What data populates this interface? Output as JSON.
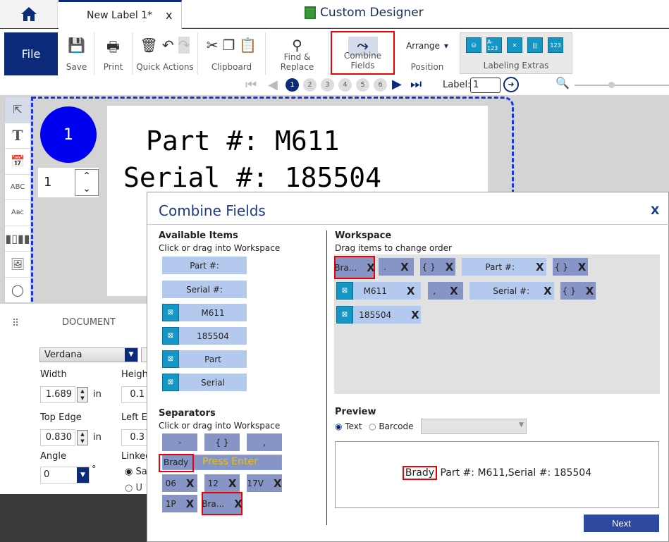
{
  "tab": {
    "title": "New Label 1*",
    "close": "x"
  },
  "app_title": "Custom Designer",
  "ribbon": {
    "file": "File",
    "save": "Save",
    "print": "Print",
    "quick_actions": "Quick Actions",
    "clipboard": "Clipboard",
    "find_replace": "Find & Replace",
    "combine_fields": "Combine Fields",
    "arrange": "Arrange",
    "position": "Position",
    "labeling_extras": "Labeling Extras",
    "extras_icons": [
      "database-icon",
      "A-123",
      "barcode-link-icon",
      "barcode-text-icon",
      "123"
    ]
  },
  "pager": {
    "pages": [
      "1",
      "2",
      "3",
      "4",
      "5",
      "6"
    ],
    "current": "1",
    "label_text": "Label:",
    "label_value": "1"
  },
  "canvas": {
    "circle_number": "1",
    "quantity": "1",
    "line1": "Part #:  M611",
    "line2": "Serial #:  185504"
  },
  "properties": {
    "title": "DOCUMENT",
    "font": "Verdana",
    "width_label": "Width",
    "width_value": "1.689",
    "width_unit": "in",
    "height_label": "Heigh",
    "height_value": "0.1",
    "top_label": "Top Edge",
    "top_value": "0.830",
    "top_unit": "in",
    "left_label": "Left E",
    "left_value": "0.3",
    "angle_label": "Angle",
    "angle_value": "0",
    "angle_unit": "°",
    "linked_label": "Linked",
    "radio1": "Sa",
    "radio2": "U"
  },
  "dialog": {
    "title": "Combine Fields",
    "close": "X",
    "available": {
      "heading": "Available Items",
      "hint": "Click or drag into Workspace",
      "items": [
        "Part #:",
        "Serial #:",
        "M611",
        "185504",
        "Part",
        "Serial"
      ]
    },
    "separators": {
      "heading": "Separators",
      "hint": "Click or drag into Workspace",
      "fixed": [
        "-",
        "{ }",
        ","
      ],
      "input_value": "Brady",
      "input_hint": "Press Enter",
      "custom": [
        "06",
        "12",
        "17V",
        "1P",
        "Bra..."
      ],
      "remove": "X"
    },
    "workspace": {
      "heading": "Workspace",
      "hint": "Drag items to change order",
      "items": [
        "Bra...",
        ".",
        "{ }",
        "Part #:",
        "{ }",
        "M611",
        ",",
        "Serial #:",
        "{ }",
        "185504"
      ],
      "remove": "X"
    },
    "preview": {
      "heading": "Preview",
      "text_option": "Text",
      "barcode_option": "Barcode",
      "selected": "Text",
      "result_highlight": "Brady",
      "result_rest": "Part #:  M611,Serial #:  185504"
    },
    "next": "Next"
  },
  "colors": {
    "brand": "#0b2a7a",
    "field": "#b4c9ee",
    "separator": "#8794c6",
    "data_icon": "#1596c4",
    "highlight": "#e00000",
    "hint": "#f0c000"
  }
}
